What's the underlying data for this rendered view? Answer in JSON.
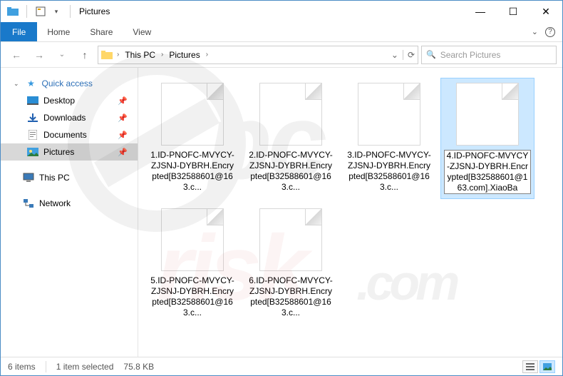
{
  "titlebar": {
    "separator": "|",
    "title": "Pictures"
  },
  "window_controls": {
    "minimize": "—",
    "maximize": "☐",
    "close": "✕"
  },
  "ribbon": {
    "file": "File",
    "tabs": [
      "Home",
      "Share",
      "View"
    ],
    "collapse": "⌄",
    "help": "?"
  },
  "nav": {
    "back": "←",
    "forward": "→",
    "recent": "⌄",
    "up": "↑"
  },
  "breadcrumb": {
    "segments": [
      "This PC",
      "Pictures"
    ],
    "chevron": "›",
    "dropdown": "⌄",
    "refresh": "⟳"
  },
  "search": {
    "icon": "🔍",
    "placeholder": "Search Pictures"
  },
  "sidebar": {
    "quick_access": {
      "expand": "⌄",
      "icon": "★",
      "label": "Quick access"
    },
    "items": [
      {
        "icon": "🖥",
        "label": "Desktop",
        "pinned": true
      },
      {
        "icon": "⬇",
        "label": "Downloads",
        "pinned": true
      },
      {
        "icon": "📄",
        "label": "Documents",
        "pinned": true
      },
      {
        "icon": "🖼",
        "label": "Pictures",
        "pinned": true,
        "active": true
      }
    ],
    "this_pc": {
      "icon": "🖥",
      "label": "This PC"
    },
    "network": {
      "icon": "🖧",
      "label": "Network"
    },
    "pin_char": "📌"
  },
  "files": [
    {
      "label": "1.ID-PNOFC-MVYCY-ZJSNJ-DYBRH.Encrypted[B32588601@163.c...",
      "selected": false
    },
    {
      "label": "2.ID-PNOFC-MVYCY-ZJSNJ-DYBRH.Encrypted[B32588601@163.c...",
      "selected": false
    },
    {
      "label": "3.ID-PNOFC-MVYCY-ZJSNJ-DYBRH.Encrypted[B32588601@163.c...",
      "selected": false
    },
    {
      "label": "4.ID-PNOFC-MVYCY-ZJSNJ-DYBRH.Encrypted[B32588601@163.com].XiaoBa",
      "selected": true
    },
    {
      "label": "5.ID-PNOFC-MVYCY-ZJSNJ-DYBRH.Encrypted[B32588601@163.c...",
      "selected": false
    },
    {
      "label": "6.ID-PNOFC-MVYCY-ZJSNJ-DYBRH.Encrypted[B32588601@163.c...",
      "selected": false
    }
  ],
  "statusbar": {
    "count": "6 items",
    "selection": "1 item selected",
    "size": "75.8 KB"
  }
}
